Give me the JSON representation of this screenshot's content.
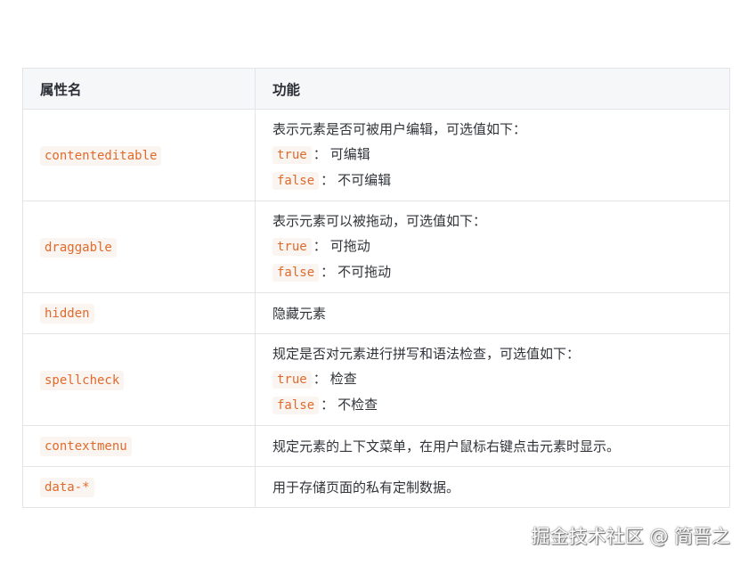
{
  "table": {
    "headers": [
      "属性名",
      "功能"
    ],
    "rows": [
      {
        "name": "contenteditable",
        "desc": "表示元素是否可被用户编辑，可选值如下：",
        "options": [
          {
            "value": "true",
            "text": "可编辑"
          },
          {
            "value": "false",
            "text": "不可编辑"
          }
        ]
      },
      {
        "name": "draggable",
        "desc": "表示元素可以被拖动，可选值如下：",
        "options": [
          {
            "value": "true",
            "text": "可拖动"
          },
          {
            "value": "false",
            "text": "不可拖动"
          }
        ]
      },
      {
        "name": "hidden",
        "desc": "隐藏元素",
        "options": []
      },
      {
        "name": "spellcheck",
        "desc": "规定是否对元素进行拼写和语法检查，可选值如下：",
        "options": [
          {
            "value": "true",
            "text": "检查"
          },
          {
            "value": "false",
            "text": "不检查"
          }
        ]
      },
      {
        "name": "contextmenu",
        "desc": "规定元素的上下文菜单，在用户鼠标右键点击元素时显示。",
        "options": []
      },
      {
        "name": "data-*",
        "desc": "用于存储页面的私有定制数据。",
        "options": []
      }
    ],
    "separator": "："
  },
  "watermark": "掘金技术社区 @ 简晋之",
  "colors": {
    "code_text": "#e06a2c",
    "code_bg": "#fbf5f1",
    "header_bg": "#f6f7f8",
    "border": "#e2e4e8"
  }
}
